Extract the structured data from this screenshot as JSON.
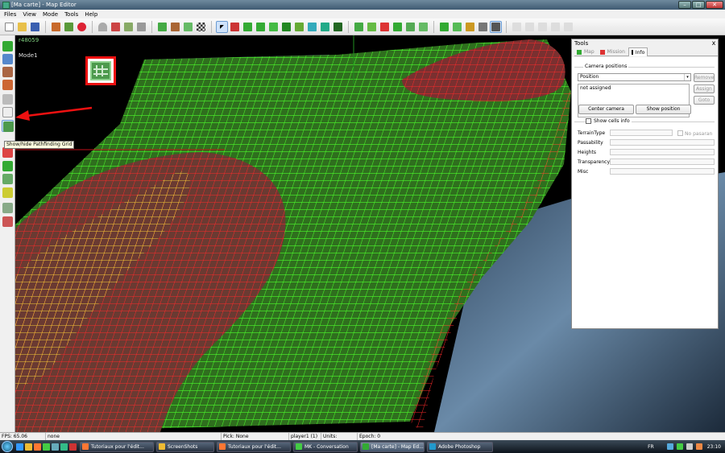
{
  "window": {
    "title": "[Ma carte] - Map Editor",
    "minimize": "–",
    "maximize": "□",
    "close": "✕"
  },
  "menu": [
    "Files",
    "View",
    "Mode",
    "Tools",
    "Help"
  ],
  "viewport": {
    "id_label": "r48059",
    "mode_label": "Mode1",
    "tooltip": "Show/hide Pathfinding Grid"
  },
  "tools_panel": {
    "title": "Tools",
    "close": "x",
    "tabs": [
      {
        "label": "Map",
        "active": false
      },
      {
        "label": "Mission",
        "active": false
      },
      {
        "label": "Info",
        "active": true
      }
    ],
    "camera_group": "Camera positions",
    "position_select": "Position",
    "dropdown_arrow": "▾",
    "list_item": "not assigned",
    "remove_button": "Remove",
    "assign_button": "Assign",
    "goto_button": "Goto",
    "center_camera_button": "Center camera",
    "show_position_button": "Show position",
    "show_cells_info": "Show cells info",
    "fields": [
      "TerrainType",
      "Passability",
      "Heights",
      "Transparency",
      "Misc"
    ],
    "no_pasaran": "No pasaran"
  },
  "statusbar": {
    "fps": "FPS: 65.06",
    "selection": "none",
    "pick": "Pick: None",
    "player": "player1 (1)",
    "units": "Units:",
    "epoch": "Epoch: 0"
  },
  "taskbar": {
    "tasks": [
      {
        "label": "Tutoriaux pour l'édit...",
        "active": false
      },
      {
        "label": "ScreenShots",
        "active": false
      },
      {
        "label": "Tutoriaux pour l'édit...",
        "active": false
      },
      {
        "label": "MK - Conversation",
        "active": false
      },
      {
        "label": "[Ma carte] - Map Ed...",
        "active": true
      },
      {
        "label": "Adobe Photoshop",
        "active": false
      }
    ],
    "lang": "FR",
    "time": "23:10"
  },
  "colors": {
    "grid_green": "#4cff2a",
    "grid_red": "#ff2a2a",
    "grid_yellow": "#f2e23a",
    "callout_red": "#ee1111"
  }
}
